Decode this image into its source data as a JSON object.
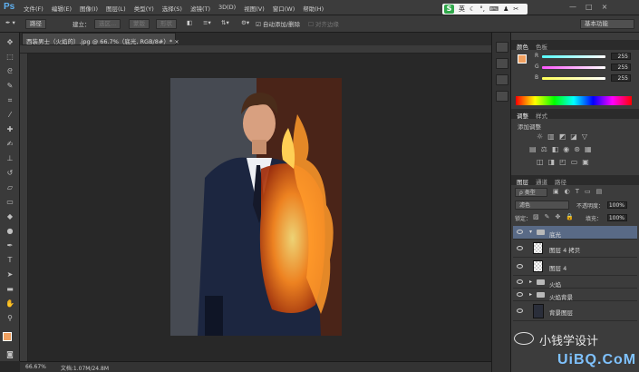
{
  "app": {
    "logo": "Ps",
    "menus": [
      "文件(F)",
      "编辑(E)",
      "图像(I)",
      "图层(L)",
      "类型(Y)",
      "选择(S)",
      "滤镜(T)",
      "3D(D)",
      "视图(V)",
      "窗口(W)",
      "帮助(H)"
    ]
  },
  "ime": {
    "logo": "S",
    "mode": "英"
  },
  "window_buttons": [
    "—",
    "□",
    "×"
  ],
  "options": {
    "tool_mode": "路径",
    "make_label": "建立：",
    "selection_btn": "选区...",
    "mask_btn": "蒙版",
    "shape_btn": "形状",
    "auto_add_delete": "自动添加/删除",
    "align_edges": "对齐边缘",
    "workspace": "基本功能"
  },
  "document": {
    "tab_title": "西装男士（火焰的）.jpg @ 66.7%（底光, RGB/8#）*",
    "zoom": "66.67%",
    "doc_size": "文档:1.07M/24.8M"
  },
  "color_panel": {
    "tabs": [
      "颜色",
      "色板"
    ],
    "foreground": "#f0a060",
    "channels": [
      {
        "label": "R",
        "value": "255",
        "color": "#ff5555"
      },
      {
        "label": "G",
        "value": "255",
        "color": "#55ff55"
      },
      {
        "label": "B",
        "value": "255",
        "color": "#5599ff"
      }
    ]
  },
  "adjust_panel": {
    "tabs": [
      "调整",
      "样式"
    ],
    "title": "添加调整"
  },
  "layers_panel": {
    "tabs": [
      "图层",
      "通道",
      "路径"
    ],
    "filter": "ρ 类型",
    "blend": "滤色",
    "opacity_label": "不透明度：",
    "opacity": "100%",
    "lock_label": "锁定：",
    "fill_label": "填充：",
    "fill": "100%",
    "layers": [
      {
        "name": "底光",
        "type": "folder",
        "selected": true
      },
      {
        "name": "图层 4 拷贝",
        "type": "layer",
        "selected": false
      },
      {
        "name": "图层 4",
        "type": "layer",
        "selected": false
      },
      {
        "name": "火焰",
        "type": "folder",
        "selected": false
      },
      {
        "name": "火焰背景",
        "type": "folder",
        "selected": false
      },
      {
        "name": "背景图层",
        "type": "image",
        "selected": false
      }
    ]
  },
  "watermark": {
    "text": "小钱学设计",
    "site": "UiBQ.CoM"
  }
}
